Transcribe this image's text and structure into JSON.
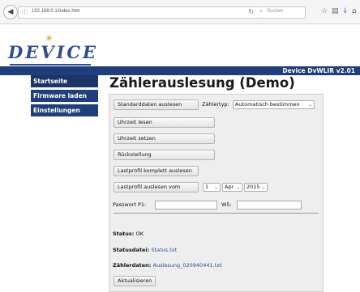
{
  "browser": {
    "url": "192.168.0.1/index.htm",
    "search_placeholder": "Suchen",
    "back_icon": "back-arrow-icon"
  },
  "logo": {
    "text": "DEVICE"
  },
  "header": {
    "version": "Device DvWLIR v2.01"
  },
  "sidebar": {
    "items": [
      {
        "label": "Startseite",
        "active": true
      },
      {
        "label": "Firmware laden",
        "active": false
      },
      {
        "label": "Einstellungen",
        "active": false
      }
    ]
  },
  "main": {
    "title": "Zählerauslesung (Demo)",
    "buttons": {
      "read_standard": "Standarddaten auslesen",
      "read_time": "Uhrzeit lesen",
      "set_time": "Uhrzeit setzen",
      "reset": "Rückstellung",
      "read_profile_full": "Lastprofil komplett auslesen",
      "read_profile_from": "Lastprofil auslesen vom",
      "refresh": "Aktualisieren"
    },
    "meter_type": {
      "label": "Zählertyp:",
      "selected": "Automatisch bestimmen"
    },
    "date": {
      "day": "1",
      "month": "Apr",
      "year": "2015"
    },
    "password": {
      "label": "Passwort P1:",
      "value": ""
    },
    "ws": {
      "label": "W5:",
      "value": ""
    },
    "status": {
      "label": "Status:",
      "value": "OK"
    },
    "status_file": {
      "label": "Statusdatei:",
      "value": "Status.txt"
    },
    "meter_data": {
      "label": "Zählerdaten:",
      "value": "Auslesung_020940441.txt"
    }
  }
}
